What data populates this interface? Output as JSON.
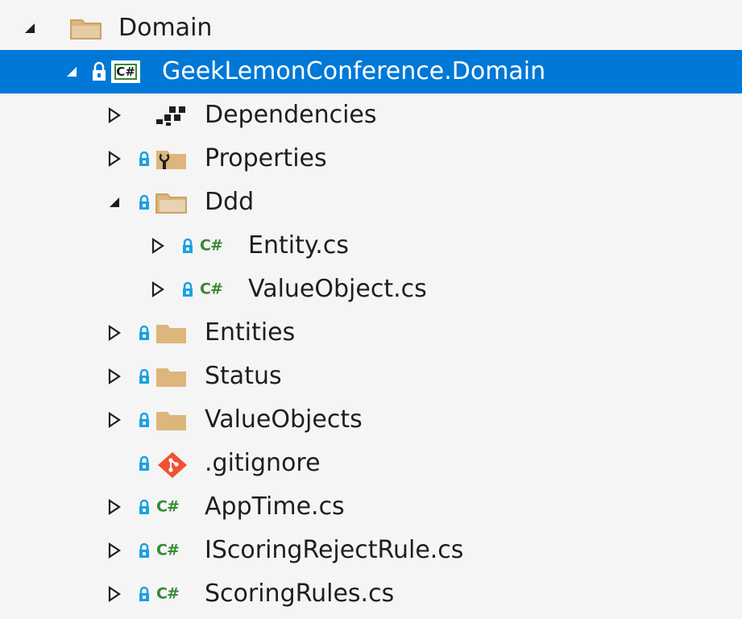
{
  "tree": {
    "items": [
      {
        "label": "Domain"
      },
      {
        "label": "GeekLemonConference.Domain"
      },
      {
        "label": "Dependencies"
      },
      {
        "label": "Properties"
      },
      {
        "label": "Ddd"
      },
      {
        "label": "Entity.cs"
      },
      {
        "label": "ValueObject.cs"
      },
      {
        "label": "Entities"
      },
      {
        "label": "Status"
      },
      {
        "label": "ValueObjects"
      },
      {
        "label": ".gitignore"
      },
      {
        "label": "AppTime.cs"
      },
      {
        "label": "IScoringRejectRule.cs"
      },
      {
        "label": "ScoringRules.cs"
      }
    ],
    "project_badge": "C#",
    "cs_badge": "C#"
  },
  "colors": {
    "selection": "#0078d7",
    "background": "#f5f5f5",
    "csharp_green": "#388a34",
    "folder": "#dcb67a",
    "lock_blue": "#1ba1e2",
    "git_red": "#f05133"
  }
}
